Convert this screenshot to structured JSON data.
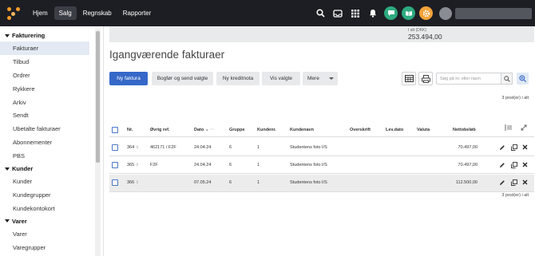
{
  "nav": {
    "items": [
      "Hjem",
      "Salg",
      "Regnskab",
      "Rapporter"
    ],
    "active": "Salg"
  },
  "top_icons": [
    "search-icon",
    "inbox-icon",
    "apps-grid-icon",
    "bell-icon",
    "chat-icon",
    "book-icon",
    "gear-icon",
    "avatar"
  ],
  "colors": {
    "topbar": "#1d1e24",
    "accent": "#3568c8",
    "chat": "#2daa7f",
    "gear": "#f2a33a",
    "logo": "#f59d2a"
  },
  "sidebar": {
    "sections": [
      {
        "label": "Fakturering",
        "items": [
          "Fakturaer",
          "Tilbud",
          "Ordrer",
          "Rykkere",
          "Arkiv",
          "Sendt",
          "Ubetalte fakturaer",
          "Abonnementer",
          "PBS"
        ]
      },
      {
        "label": "Kunder",
        "items": [
          "Kunder",
          "Kundegrupper",
          "Kundekontokort"
        ]
      },
      {
        "label": "Varer",
        "items": [
          "Varer",
          "Varegrupper"
        ]
      }
    ],
    "active_item": "Fakturaer"
  },
  "summary": {
    "label": "I alt (DKK)",
    "value": "253.494,00"
  },
  "page_title": "Igangværende fakturaer",
  "toolbar": {
    "new_invoice": "Ny faktura",
    "book_send": "Bogfør og send valgte",
    "new_credit": "Ny kreditnota",
    "show_selected": "Vis valgte",
    "more": "Mere",
    "search_placeholder": "Søg på nr. eller navn"
  },
  "post_count": "3 post(er) i alt",
  "table": {
    "headers": [
      "Nr.",
      "Øvrig ref.",
      "Dato",
      "Gruppe",
      "Kundenr.",
      "Kundenavn",
      "Overskrift",
      "Lev.dato",
      "Valuta",
      "Nettobeløb"
    ],
    "sort_marker": "▲ ···",
    "rows": [
      {
        "nr": "364",
        "ref": "462171 / F2F",
        "dato": "24.04.24",
        "gruppe": "6",
        "kundenr": "1",
        "kundenavn": "Studentens foto I/S",
        "overskrift": "",
        "levdato": "",
        "valuta": "",
        "netto": "70.497,00"
      },
      {
        "nr": "365",
        "ref": "F2F",
        "dato": "24.04.24",
        "gruppe": "6",
        "kundenr": "1",
        "kundenavn": "Studentens foto I/S",
        "overskrift": "",
        "levdato": "",
        "valuta": "",
        "netto": "70.497,00"
      },
      {
        "nr": "366",
        "ref": "",
        "dato": "07.05.24",
        "gruppe": "6",
        "kundenr": "1",
        "kundenavn": "Studentens foto I/S",
        "overskrift": "",
        "levdato": "",
        "valuta": "",
        "netto": "112.500,00"
      }
    ]
  }
}
